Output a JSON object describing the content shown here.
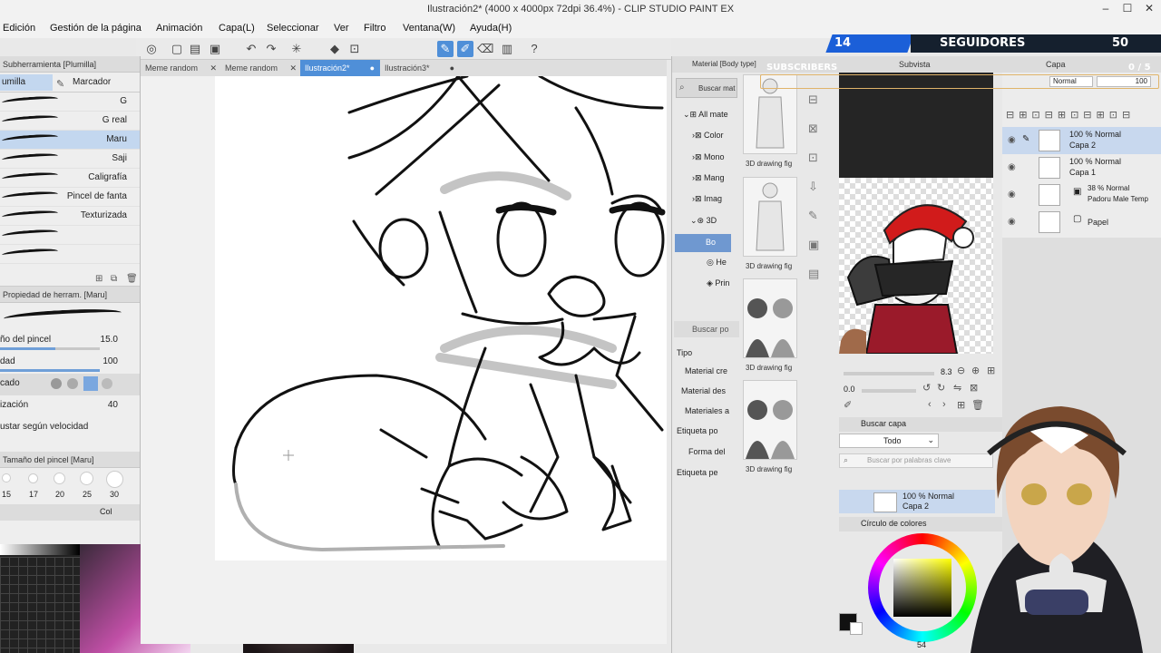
{
  "window": {
    "title": "Ilustración2* (4000 x 4000px 72dpi 36.4%) - CLIP STUDIO PAINT EX",
    "min": "–",
    "max": "☐",
    "close": "✕"
  },
  "menu": [
    "Edición",
    "Gestión de la página",
    "Animación",
    "Capa(L)",
    "Seleccionar",
    "Ver",
    "Filtro",
    "Ventana(W)",
    "Ayuda(H)"
  ],
  "left": {
    "subtool_header": "Subherramienta [Plumilla]",
    "tabs": [
      "umilla",
      "Marcador"
    ],
    "brushes": [
      "G",
      "G real",
      "Maru",
      "Saji",
      "Caligrafía",
      "Pincel de fanta",
      "Texturizada",
      "",
      ""
    ],
    "tool_property_header": "Propiedad de herram. [Maru]",
    "props": [
      {
        "name": "ño del pincel",
        "value": "15.0",
        "level": 0.55
      },
      {
        "name": "dad",
        "value": "100",
        "level": 1.0
      },
      {
        "name": "cado",
        "value": "",
        "level": 0
      },
      {
        "name": "ización",
        "value": "40",
        "level": 0.4
      }
    ],
    "speed_label": "ustar según velocidad",
    "brush_size_header": "Tamaño del pincel [Maru]",
    "sizes": [
      "15",
      "17",
      "20",
      "25",
      "30"
    ],
    "colors_tab": "Col"
  },
  "doc_tabs": [
    {
      "label": "Meme random",
      "active": false
    },
    {
      "label": "Meme random",
      "active": false
    },
    {
      "label": "Ilustración2*",
      "active": true
    },
    {
      "label": "Ilustración3*",
      "active": false
    }
  ],
  "material": {
    "header": "Material [Body type]",
    "search": "Buscar mat",
    "tree": [
      "All mate",
      "Color",
      "Mono",
      "Mang",
      "Imag",
      "3D",
      "Bo",
      "He",
      "Prin"
    ],
    "search2": "Buscar po",
    "type_label": "Tipo",
    "filters": [
      "Material cre",
      "Material des",
      "Materiales a",
      "Etiqueta po",
      "Forma del",
      "Etiqueta pe"
    ],
    "thumb_caption": "3D drawing fig"
  },
  "navigator": {
    "tab": "Subvista",
    "zoom": "8.3",
    "angle": "0.0"
  },
  "layers": {
    "header": "Capa",
    "blend": "Normal",
    "opacity": "100",
    "items": [
      {
        "l1": "100 % Normal",
        "l2": "Capa 2",
        "sel": true
      },
      {
        "l1": "100 % Normal",
        "l2": "Capa 1",
        "sel": false
      },
      {
        "l1": "38 % Normal",
        "l2": "Padoru Male Temp",
        "sel": false
      },
      {
        "l1": "",
        "l2": "Papel",
        "sel": false
      }
    ]
  },
  "search_layer": {
    "tab": "Buscar capa",
    "scope": "Todo",
    "placeholder": "Buscar por palabras clave",
    "result_l1": "100 % Normal",
    "result_l2": "Capa 2"
  },
  "color_panel": {
    "tab": "Círculo de colores",
    "value": "54"
  },
  "overlay": {
    "followers_left": "14",
    "followers_label": "SEGUIDORES",
    "followers_right": "50",
    "subscribers_label": "SUBSCRIBERS",
    "subs_count": "0 / 5"
  },
  "colors": {
    "accent": "#4f8fd8",
    "overlay_blue": "#1b5fd8",
    "overlay_dark": "#15202e"
  }
}
